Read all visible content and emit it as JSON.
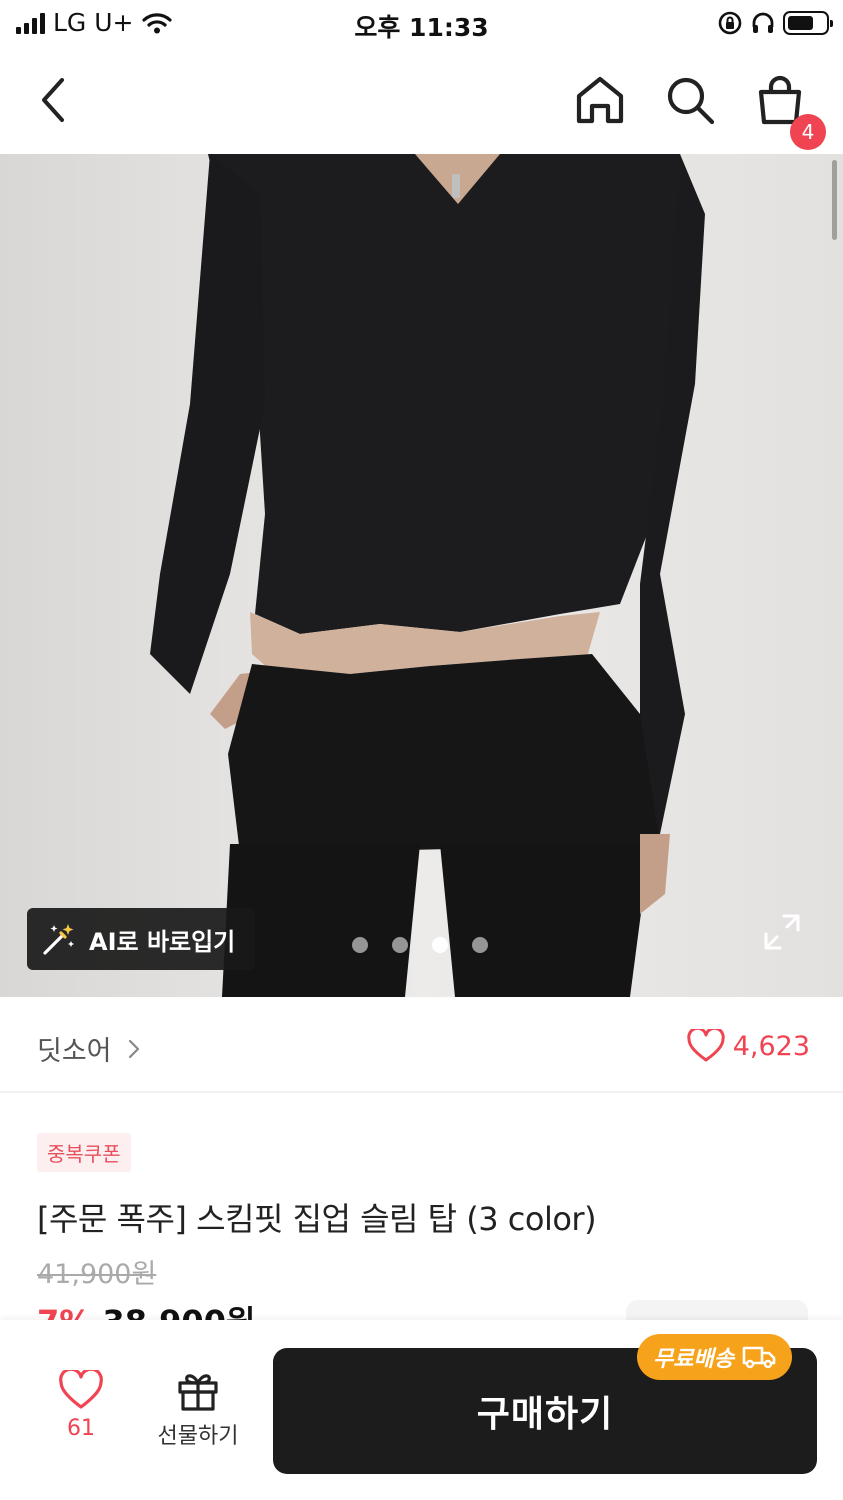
{
  "status_bar": {
    "carrier": "LG U+",
    "time": "오후 11:33"
  },
  "header": {
    "back_icon": "chevron-left-icon",
    "home_icon": "home-icon",
    "search_icon": "search-icon",
    "cart_icon": "shopping-bag-icon",
    "cart_count": "4"
  },
  "gallery": {
    "ai_try_on_label": "AI로 바로입기",
    "image_count": 4,
    "active_index": 2
  },
  "brand": {
    "name": "딧소어",
    "like_count": "4,623"
  },
  "product": {
    "coupon_badge": "중복쿠폰",
    "title": "[주문 폭주] 스킴핏 집업 슬림 탑 (3 color)",
    "original_price": "41,900원",
    "discount_rate": "7%",
    "sale_price": "38,900원"
  },
  "bottom_bar": {
    "wish_count": "61",
    "gift_label": "선물하기",
    "buy_label": "구매하기",
    "shipping_badge": "무료배송"
  },
  "colors": {
    "accent": "#f04452",
    "buy_button": "#1c1c1c",
    "shipping_badge": "#f7a21b"
  }
}
